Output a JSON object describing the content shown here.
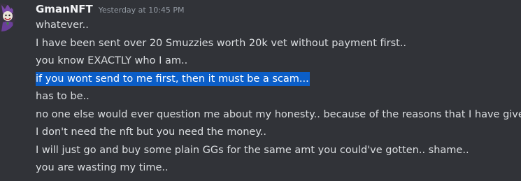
{
  "message": {
    "author": "GmanNFT",
    "timestamp": "Yesterday at 10:45 PM",
    "avatar_icon": "joker-avatar-icon",
    "selection_color": "#0b5ec8",
    "lines": [
      "whatever..",
      "I have been sent  over 20 Smuzzies worth 20k vet without payment first..",
      "you know EXACTLY who I am..",
      "if you wont send to me first, then it must be a scam...",
      "has to be..",
      "no one else would ever question me about my honesty..  because of the reasons that I have given..",
      "I don't need the nft but you need the money..",
      "I will just go and buy some plain GGs for the same amt you could've gotten.. shame..",
      "you are wasting my time.."
    ],
    "selected_line_index": 3
  }
}
